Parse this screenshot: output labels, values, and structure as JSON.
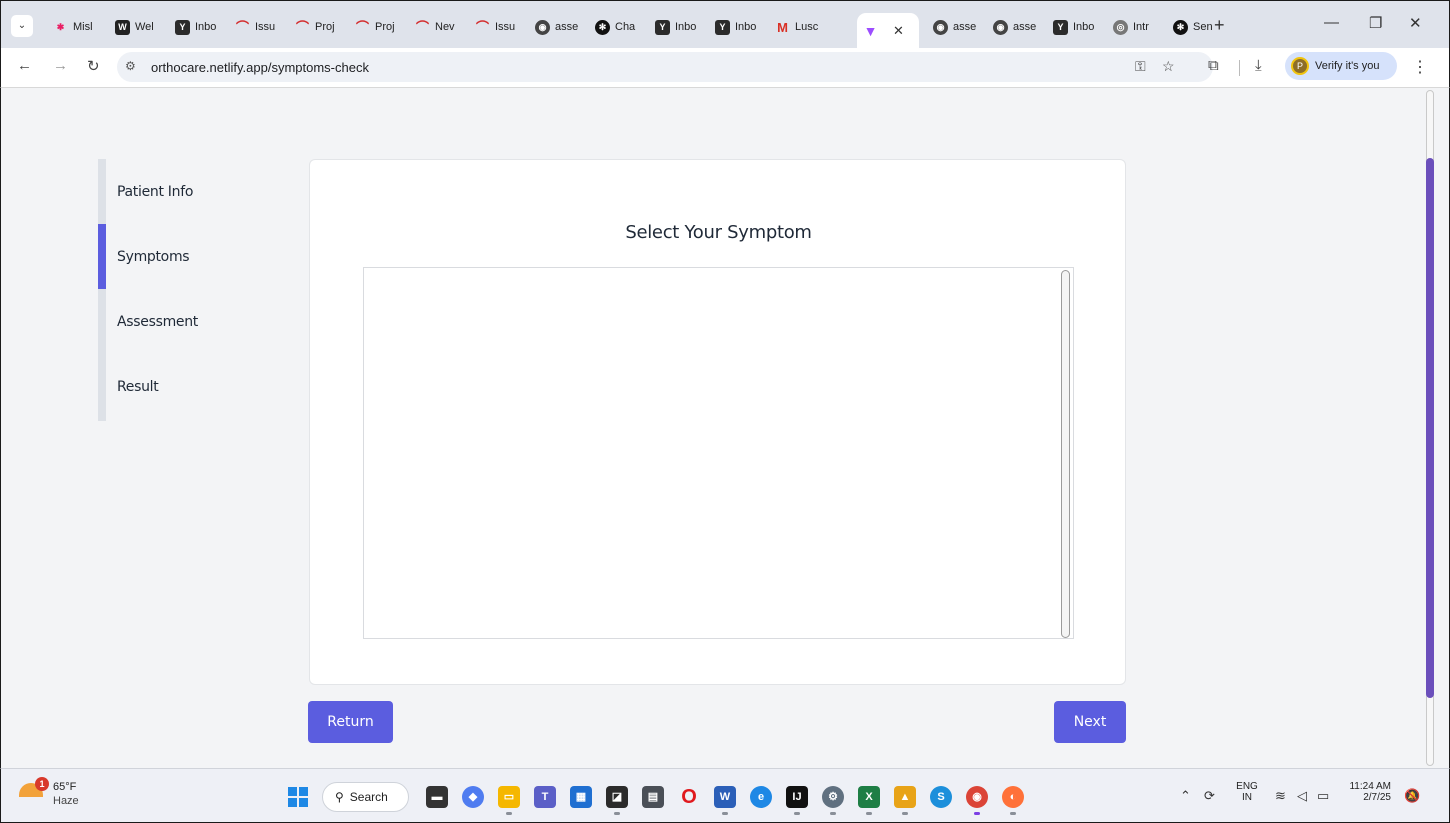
{
  "browser": {
    "tab_search_glyph": "⌄",
    "tabs": [
      {
        "label": "Misl",
        "icon": "pin-icon"
      },
      {
        "label": "Wel",
        "icon": "wellfound-icon"
      },
      {
        "label": "Inbo",
        "icon": "yahoo-mail-icon"
      },
      {
        "label": "Issu",
        "icon": "arc-icon"
      },
      {
        "label": "Proj",
        "icon": "arc-icon"
      },
      {
        "label": "Proj",
        "icon": "arc-icon"
      },
      {
        "label": "Nev",
        "icon": "arc-icon"
      },
      {
        "label": "Issu",
        "icon": "arc-icon"
      },
      {
        "label": "asse",
        "icon": "globe-icon"
      },
      {
        "label": "Cha",
        "icon": "chatgpt-icon"
      },
      {
        "label": "Inbo",
        "icon": "yahoo-mail-icon"
      },
      {
        "label": "Inbo",
        "icon": "yahoo-mail-icon"
      },
      {
        "label": "Lusc",
        "icon": "gmail-icon"
      },
      {
        "label": "",
        "icon": "vite-icon",
        "active": true
      },
      {
        "label": "asse",
        "icon": "globe-icon"
      },
      {
        "label": "asse",
        "icon": "globe-icon"
      },
      {
        "label": "Inbo",
        "icon": "yahoo-mail-icon"
      },
      {
        "label": "Intr",
        "icon": "intro-icon"
      },
      {
        "label": "Sen",
        "icon": "chatgpt-icon"
      }
    ],
    "new_tab_glyph": "+",
    "url": "orthocare.netlify.app/symptoms-check",
    "verify_label": "Verify it's you",
    "profile_initial": "P"
  },
  "page": {
    "steps": [
      {
        "label": "Patient Info",
        "active": false
      },
      {
        "label": "Symptoms",
        "active": true
      },
      {
        "label": "Assessment",
        "active": false
      },
      {
        "label": "Result",
        "active": false
      }
    ],
    "card_title": "Select Your Symptom",
    "return_label": "Return",
    "next_label": "Next",
    "accent_color": "#5b5ddf",
    "scroll_position_percent": 10
  },
  "taskbar": {
    "weather_badge": "1",
    "weather_temp": "65°F",
    "weather_condition": "Haze",
    "search_label": "Search",
    "language": "ENG",
    "region": "IN",
    "time": "11:24 AM",
    "date": "2/7/25",
    "apps": [
      "file-manager-icon",
      "copilot-icon",
      "folder-icon",
      "teams-icon",
      "store-icon",
      "sticky-notes-icon",
      "calculator-icon",
      "opera-icon",
      "word-icon",
      "edge-icon",
      "intellij-icon",
      "settings-icon",
      "excel-icon",
      "photo-icon",
      "skype-icon",
      "chrome-icon",
      "firefox-icon"
    ]
  }
}
